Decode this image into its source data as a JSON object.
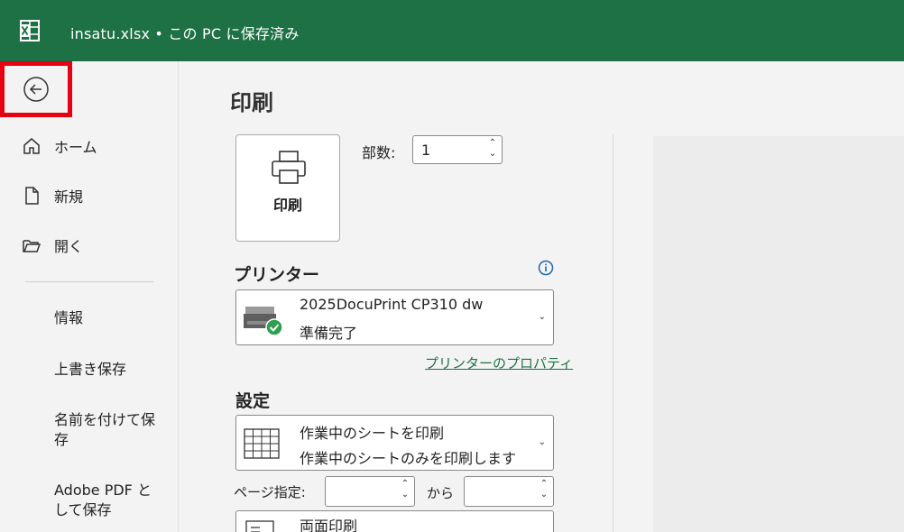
{
  "window": {
    "title": "insatu.xlsx • この PC に保存済み"
  },
  "nav": {
    "home": "ホーム",
    "new": "新規",
    "open": "開く",
    "info": "情報",
    "save": "上書き保存",
    "save_as": "名前を付けて保存",
    "adobe_pdf": "Adobe PDF として保存"
  },
  "print": {
    "heading": "印刷",
    "button_label": "印刷",
    "copies_label": "部数:",
    "copies_value": "1"
  },
  "printer": {
    "section_title": "プリンター",
    "name": "2025DocuPrint CP310 dw",
    "status": "準備完了",
    "properties_link": "プリンターのプロパティ"
  },
  "settings": {
    "section_title": "設定",
    "scope_title": "作業中のシートを印刷",
    "scope_desc": "作業中のシートのみを印刷します",
    "pages_label": "ページ指定:",
    "from_value": "",
    "to_label": "から",
    "to_value": "",
    "duplex_title": "両面印刷"
  },
  "colors": {
    "brand": "#1e7145",
    "highlight": "#e60012",
    "ready": "#2e9e4f"
  }
}
